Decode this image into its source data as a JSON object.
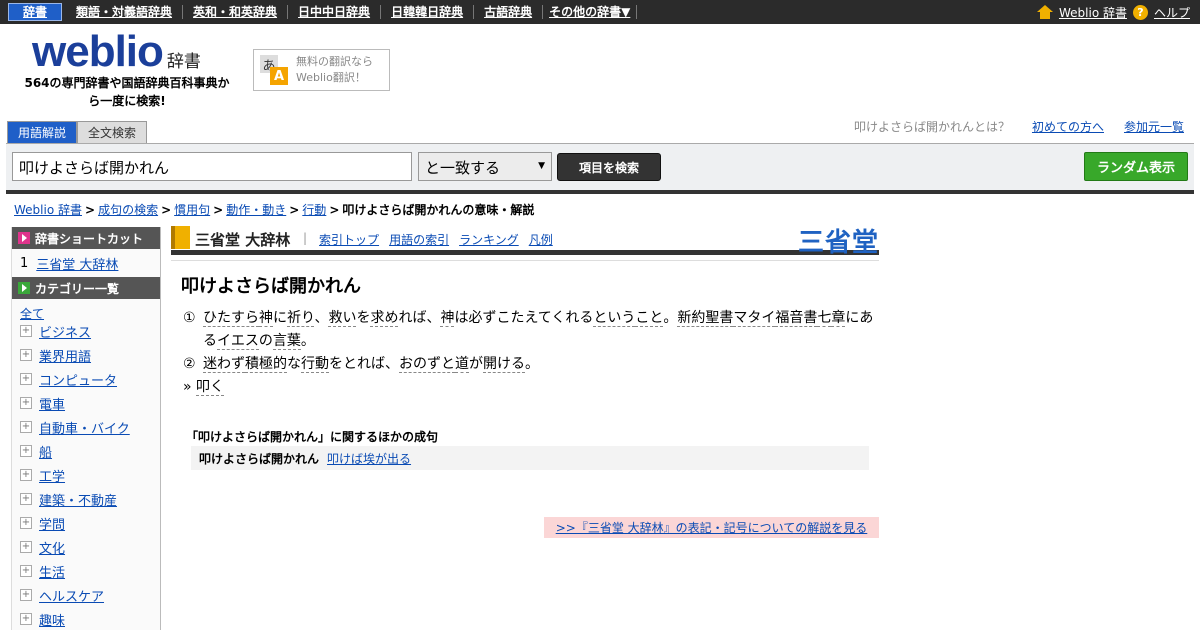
{
  "topnav": {
    "items": [
      "辞書",
      "類語・対義語辞典",
      "英和・和英辞典",
      "日中中日辞典",
      "日韓韓日辞典",
      "古語辞典",
      "その他の辞書▼"
    ],
    "weblio_link": "Weblio 辞書",
    "help": "ヘルプ",
    "help_glyph": "?"
  },
  "header": {
    "logo": "weblio",
    "logo_suffix": "辞書",
    "tagline": "564の専門辞書や国語辞典百科事典から一度に検索!",
    "promo_line1": "無料の翻訳なら",
    "promo_line2": "Weblio翻訳！",
    "promo_glyph1": "あ",
    "promo_glyph2": "A"
  },
  "tabs": [
    "用語解説",
    "全文検索"
  ],
  "head_links": {
    "question": "叩けよさらば開かれんとは？",
    "first_time": "初めての方へ",
    "sources": "参加元一覧"
  },
  "search": {
    "value": "叩けよさらば開かれん",
    "match": "と一致する",
    "search_button": "項目を検索",
    "random_button": "ランダム表示"
  },
  "breadcrumb": [
    "Weblio 辞書",
    "成句の検索",
    "慣用句",
    "動作・動き",
    "行動"
  ],
  "breadcrumb_sep": ">",
  "breadcrumb_current": "叩けよさらば開かれんの意味・解説",
  "sidebar": {
    "shortcut_title": "辞書ショートカット",
    "shortcut_num": "1",
    "shortcut_item": "三省堂 大辞林",
    "category_title": "カテゴリー一覧",
    "all": "全て",
    "plus": "+",
    "categories": [
      "ビジネス",
      "業界用語",
      "コンピュータ",
      "電車",
      "自動車・バイク",
      "船",
      "工学",
      "建築・不動産",
      "学問",
      "文化",
      "生活",
      "ヘルスケア",
      "趣味"
    ]
  },
  "dict": {
    "name": "三省堂 大辞林",
    "links": [
      "索引トップ",
      "用語の索引",
      "ランキング",
      "凡例"
    ],
    "link_sep": "|",
    "brand": "三省堂"
  },
  "entry": {
    "title": "叩けよさらば開かれん",
    "defs": [
      {
        "num": "①",
        "segments": [
          "ひたすら",
          "神",
          "に",
          "祈り",
          "、",
          "救い",
          "を",
          "求め",
          "れば、",
          "神",
          "は必ずこたえてくれる",
          "という",
          "こと",
          "。",
          "新約聖書",
          "マタイ",
          "福音書",
          "七",
          "章",
          "にある",
          "イエス",
          "の",
          "言葉",
          "。"
        ]
      },
      {
        "num": "②",
        "segments": [
          "迷わず",
          "積極的",
          "な",
          "行動",
          "をとれば、",
          "おのずと",
          "道",
          "が",
          "開ける",
          "。"
        ]
      }
    ],
    "ref_prefix": "»",
    "ref_word": "叩く"
  },
  "related": {
    "title": "「叩けよさらば開かれん」に関するほかの成句",
    "current": "叩けよさらば開かれん",
    "link": "叩けば埃が出る"
  },
  "notation": ">>『三省堂 大辞林』の表記・記号についての解説を見る",
  "colors": {
    "topbar": "#2b2b2b",
    "accent_blue": "#1f5fc8",
    "brand_blue": "#1f62c2",
    "random_green": "#38a82a",
    "notation_bg": "#fbd6d6"
  }
}
